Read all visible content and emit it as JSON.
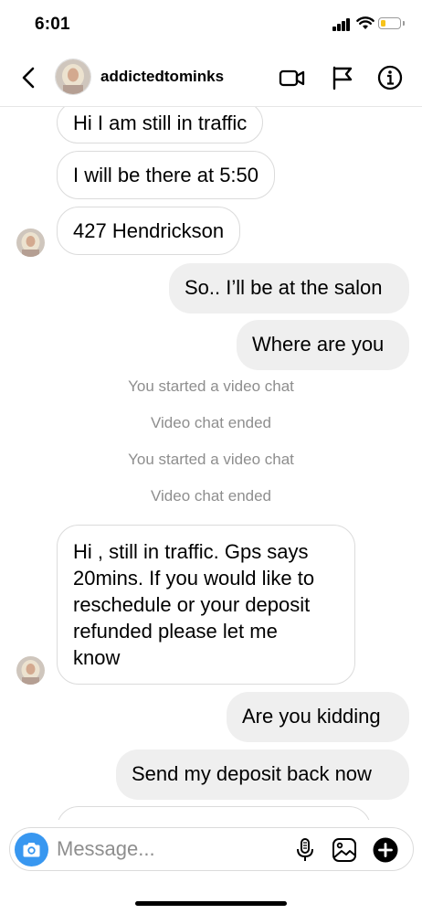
{
  "status_bar": {
    "time": "6:01",
    "battery_level": 0.25,
    "battery_color": "#f7c31a"
  },
  "header": {
    "username": "addictedtominks",
    "icons": [
      "chevron-left-icon",
      "video-camera-icon",
      "flag-icon",
      "info-icon"
    ]
  },
  "messages": [
    {
      "direction": "incoming",
      "text": "Hi I am still in traffic"
    },
    {
      "direction": "incoming",
      "text": "I will be there at 5:50"
    },
    {
      "direction": "incoming",
      "text": "427 Hendrickson"
    },
    {
      "direction": "outgoing",
      "text": "So.. I’ll be at the salon"
    },
    {
      "direction": "outgoing",
      "text": "Where are you"
    },
    {
      "direction": "system",
      "text": "You started a video chat"
    },
    {
      "direction": "system",
      "text": "Video chat ended"
    },
    {
      "direction": "system",
      "text": "You started a video chat"
    },
    {
      "direction": "system",
      "text": "Video chat ended"
    },
    {
      "direction": "incoming",
      "lines": [
        "Hi , still in traffic. Gps says",
        "20mins. If you would like to",
        "reschedule or your deposit",
        "refunded please let me",
        "know"
      ]
    },
    {
      "direction": "outgoing",
      "text": "Are you kidding"
    },
    {
      "direction": "outgoing",
      "text": "Send my deposit back now"
    }
  ],
  "composer": {
    "placeholder": "Message...",
    "icons": [
      "camera-icon",
      "microphone-icon",
      "gallery-icon",
      "plus-icon"
    ]
  },
  "colors": {
    "incoming_bubble_border": "#dbdbdb",
    "outgoing_bubble_bg": "#efefef",
    "system_text": "#8e8e8e",
    "camera_button": "#3897f0"
  }
}
